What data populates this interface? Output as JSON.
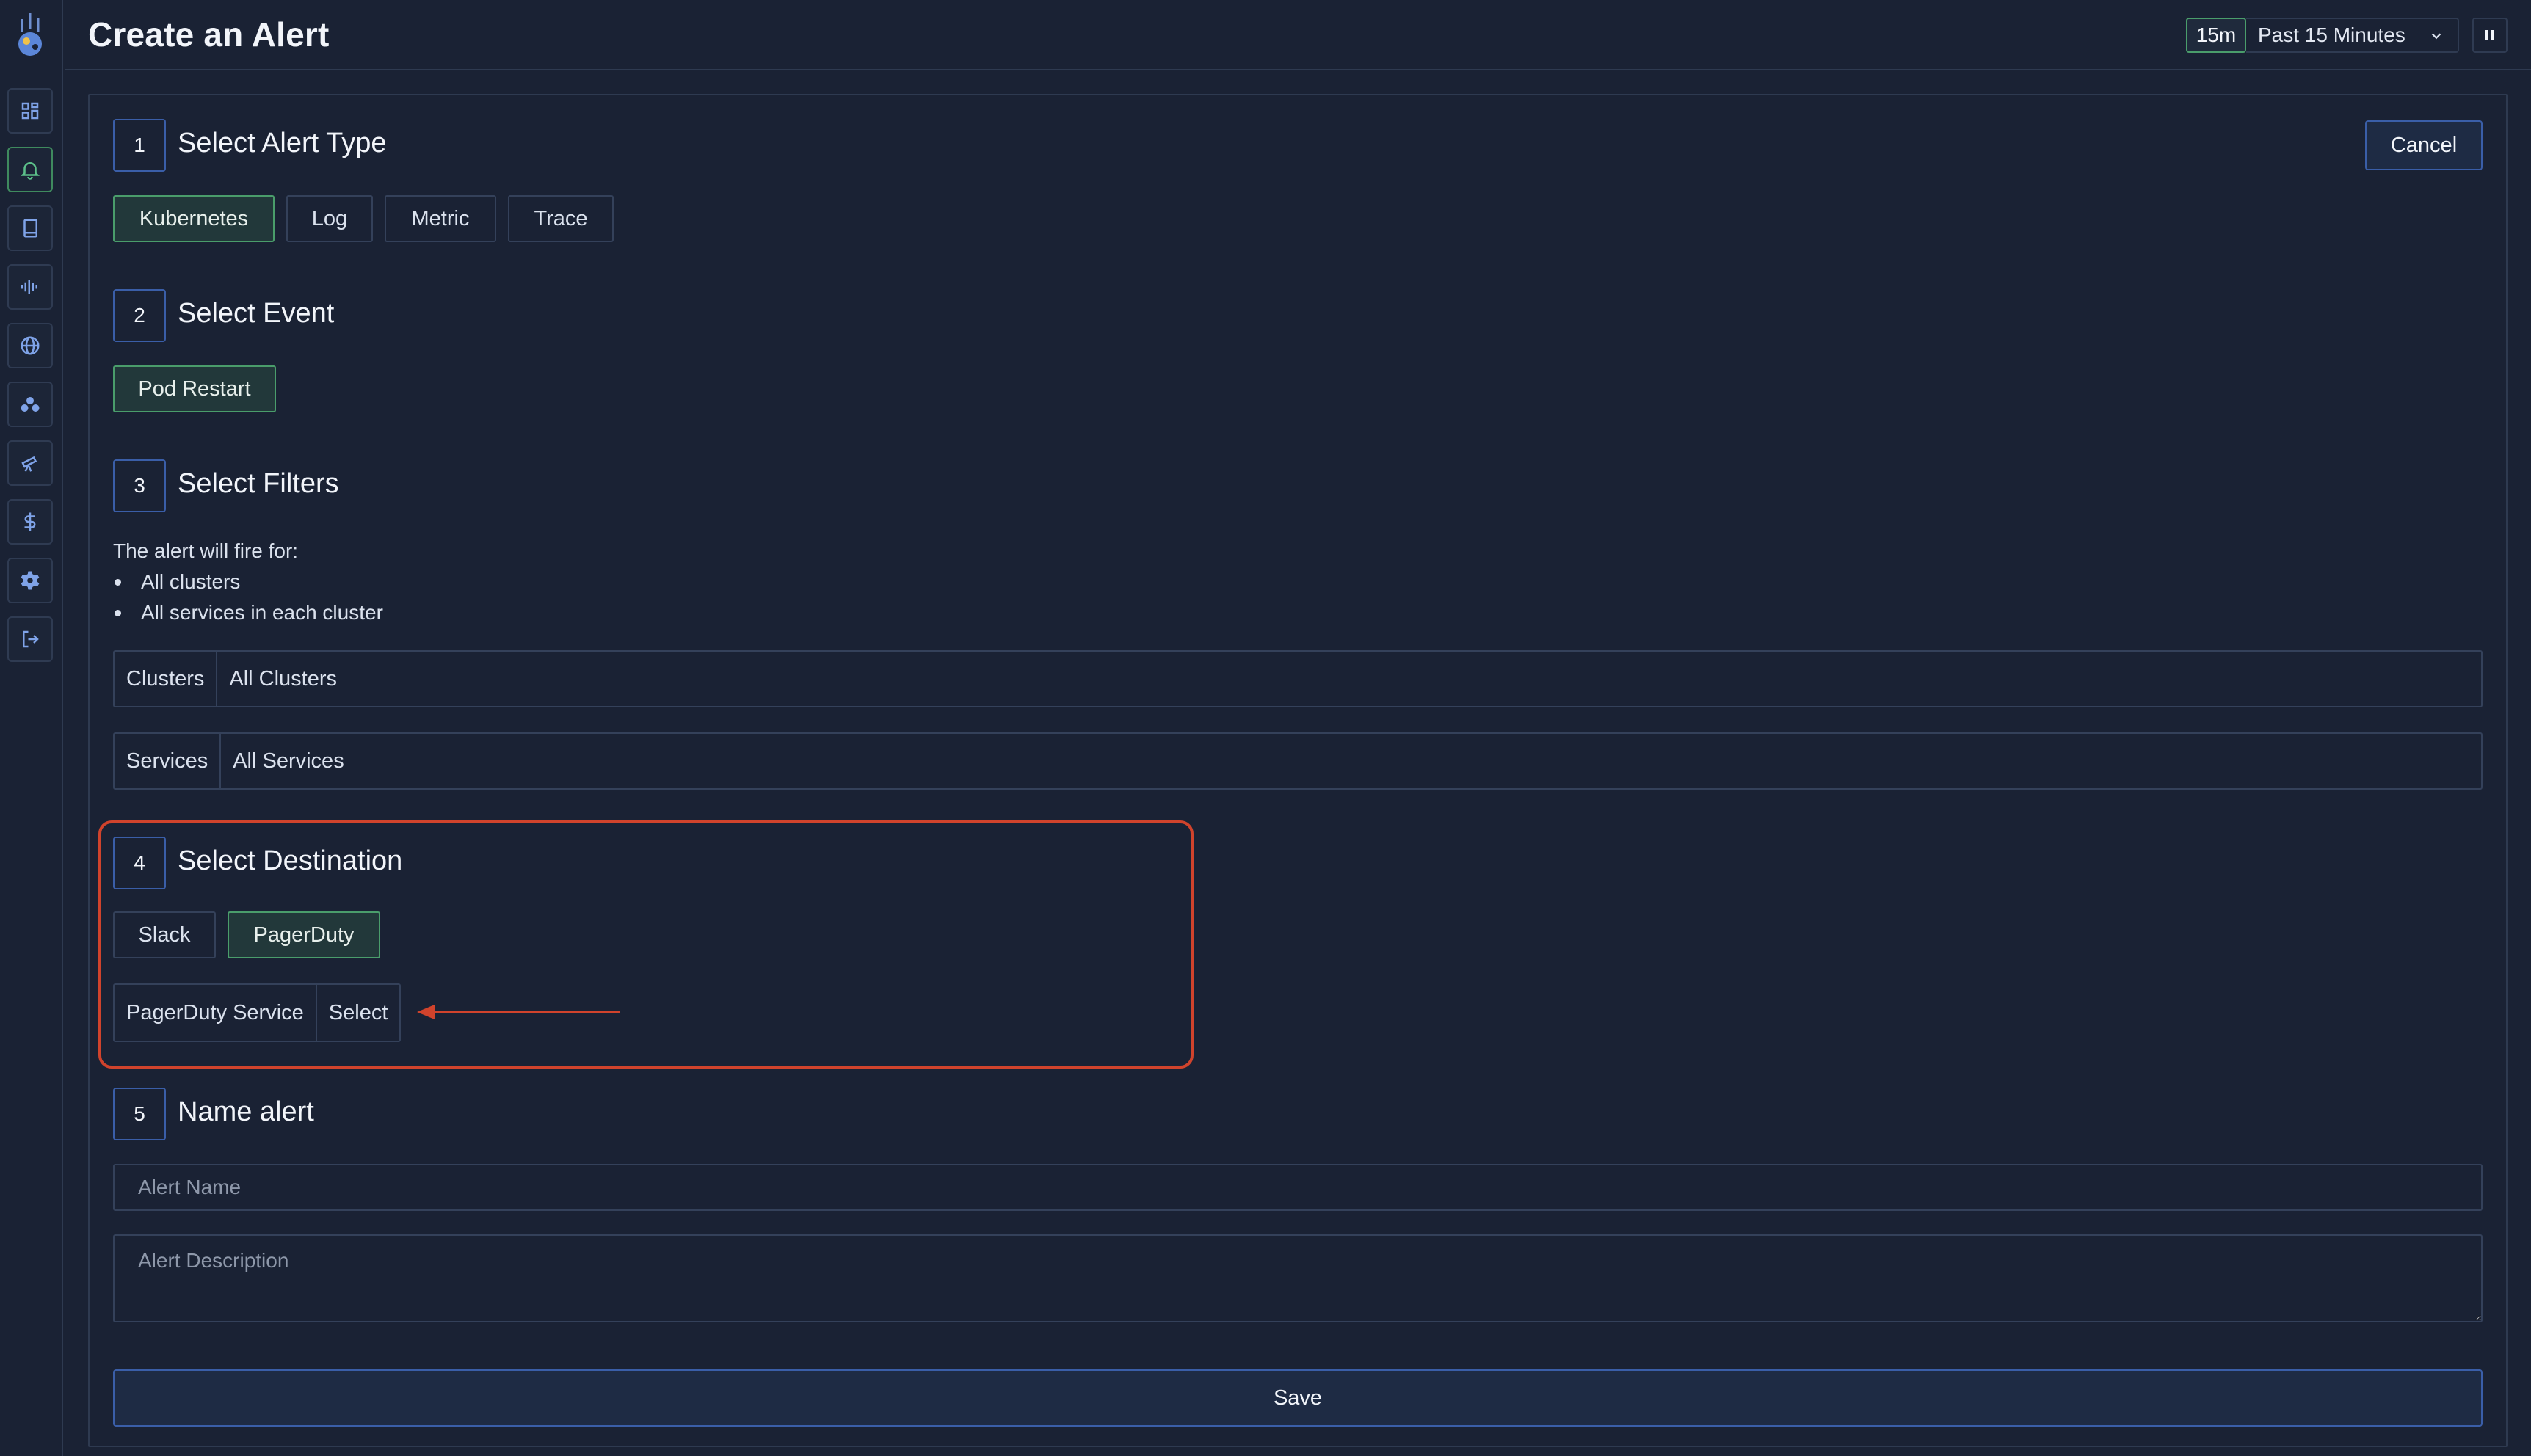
{
  "header": {
    "title": "Create an Alert",
    "time_badge": "15m",
    "time_range": "Past 15 Minutes"
  },
  "sidebar": {
    "items": [
      {
        "icon": "dashboard-icon"
      },
      {
        "icon": "bell-icon",
        "active": true
      },
      {
        "icon": "book-icon"
      },
      {
        "icon": "waveform-icon"
      },
      {
        "icon": "globe-icon"
      },
      {
        "icon": "cluster-icon"
      },
      {
        "icon": "telescope-icon"
      },
      {
        "icon": "dollar-icon"
      },
      {
        "icon": "gear-icon"
      },
      {
        "icon": "logout-icon"
      }
    ]
  },
  "form": {
    "cancel_label": "Cancel",
    "step1": {
      "number": "1",
      "title": "Select Alert Type",
      "options": [
        "Kubernetes",
        "Log",
        "Metric",
        "Trace"
      ],
      "selected": "Kubernetes"
    },
    "step2": {
      "number": "2",
      "title": "Select Event",
      "options": [
        "Pod Restart"
      ],
      "selected": "Pod Restart"
    },
    "step3": {
      "number": "3",
      "title": "Select Filters",
      "description": "The alert will fire for:",
      "bullets": [
        "All clusters",
        "All services in each cluster"
      ],
      "filters": [
        {
          "label": "Clusters",
          "value": "All Clusters"
        },
        {
          "label": "Services",
          "value": "All Services"
        }
      ]
    },
    "step4": {
      "number": "4",
      "title": "Select Destination",
      "options": [
        "Slack",
        "PagerDuty"
      ],
      "selected": "PagerDuty",
      "service_label": "PagerDuty Service",
      "service_value": "Select"
    },
    "step5": {
      "number": "5",
      "title": "Name alert",
      "name_placeholder": "Alert Name",
      "description_placeholder": "Alert Description"
    },
    "save_label": "Save"
  },
  "colors": {
    "background": "#1a2234",
    "selected_border": "#4a9d6b",
    "accent_border": "#3a5ea8",
    "highlight": "#d0432c"
  }
}
